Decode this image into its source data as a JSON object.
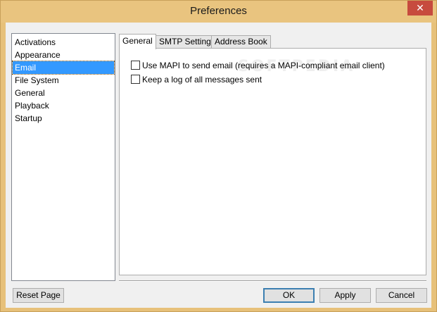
{
  "window": {
    "title": "Preferences",
    "close_glyph": "✕"
  },
  "categories": [
    {
      "label": "Activations"
    },
    {
      "label": "Appearance"
    },
    {
      "label": "Email"
    },
    {
      "label": "File System"
    },
    {
      "label": "General"
    },
    {
      "label": "Playback"
    },
    {
      "label": "Startup"
    }
  ],
  "selected_category": "Email",
  "tabs": [
    {
      "label": "General"
    },
    {
      "label": "SMTP Settings"
    },
    {
      "label": "Address Book"
    }
  ],
  "active_tab": "General",
  "options": [
    {
      "label": "Use MAPI to send email (requires a MAPI-compliant email client)",
      "checked": false
    },
    {
      "label": "Keep a log of all messages sent",
      "checked": false
    }
  ],
  "watermark": "SOFTPEDIA",
  "buttons": {
    "reset": "Reset Page",
    "ok": "OK",
    "apply": "Apply",
    "cancel": "Cancel"
  },
  "colors": {
    "title_bar": "#e9c47f",
    "close_button": "#c74b3e",
    "selection": "#3399ff"
  }
}
